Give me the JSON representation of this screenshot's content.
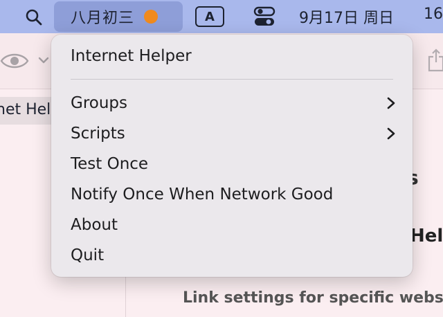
{
  "menubar": {
    "app_label": "八月初三",
    "input_indicator": "A",
    "date": "9月17日 周日",
    "time": "16",
    "status_dot_color": "#f08a1d"
  },
  "window": {
    "sidebar_selected_label": "net Hel",
    "period": ".",
    "partial_heading": "s",
    "partial_title": "Help",
    "link_settings": "Link settings for specific websit"
  },
  "menu": {
    "header": "Internet Helper",
    "items": [
      {
        "label": "Groups",
        "submenu": true
      },
      {
        "label": "Scripts",
        "submenu": true
      },
      {
        "label": "Test Once",
        "submenu": false
      },
      {
        "label": "Notify Once When Network Good",
        "submenu": false
      },
      {
        "label": "About",
        "submenu": false
      },
      {
        "label": "Quit",
        "submenu": false
      }
    ]
  }
}
